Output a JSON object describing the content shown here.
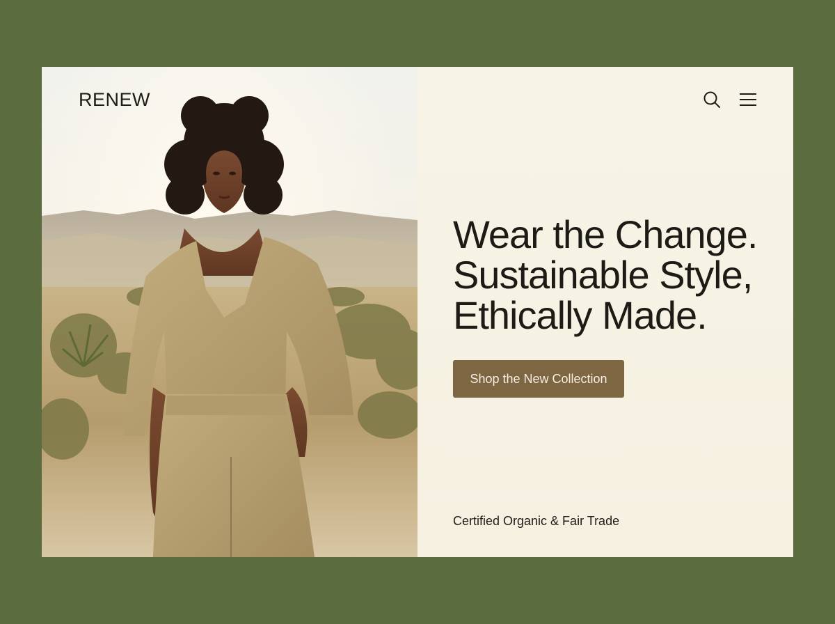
{
  "brand": {
    "name": "RENEW"
  },
  "header": {
    "search_icon": "search-icon",
    "menu_icon": "hamburger-menu-icon"
  },
  "hero": {
    "headline_lines": [
      "Wear the Change.",
      "Sustainable Style,",
      "Ethically Made."
    ],
    "cta_label": "Shop the New Collection",
    "certification": "Certified Organic & Fair Trade"
  },
  "colors": {
    "background": "#5b6c3e",
    "panel": "#f6f2e4",
    "accent": "#7f6642",
    "text": "#1c1b16"
  }
}
